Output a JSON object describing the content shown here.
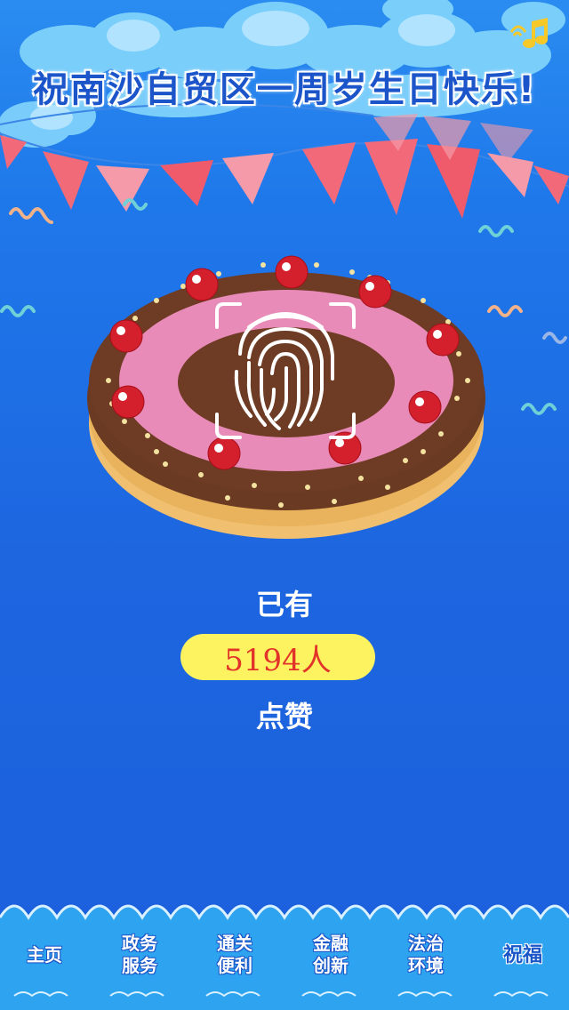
{
  "header": {
    "title": "祝南沙自贸区一周岁生日快乐!",
    "music_icon": "music-note-icon"
  },
  "main": {
    "count_prefix": "已有",
    "count_value": "5194人",
    "count_suffix": "点赞",
    "fingerprint_icon": "fingerprint-icon"
  },
  "nav": {
    "items": [
      {
        "line1": "主页",
        "line2": ""
      },
      {
        "line1": "政务",
        "line2": "服务"
      },
      {
        "line1": "通关",
        "line2": "便利"
      },
      {
        "line1": "金融",
        "line2": "创新"
      },
      {
        "line1": "法治",
        "line2": "环境"
      },
      {
        "line1": "祝福",
        "line2": ""
      }
    ],
    "active_index": 5
  },
  "colors": {
    "background": "#1f6fe6",
    "title_text": "#1b55c9",
    "pill": "#fdf260",
    "count_text": "#e2332a",
    "wave": "#d8f0ff"
  }
}
